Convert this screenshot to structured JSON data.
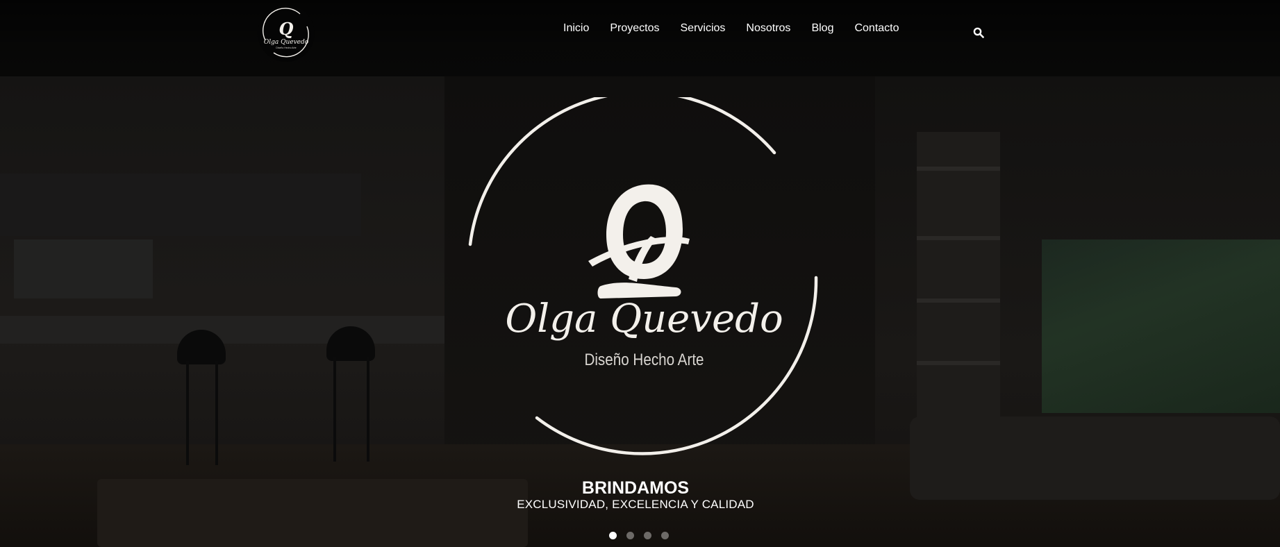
{
  "header": {
    "logo_alt": "Olga Quevedo",
    "logo_text": "Olga Quevedo",
    "logo_tagline": "Diseño Hecho Arte",
    "nav": [
      {
        "label": "Inicio"
      },
      {
        "label": "Proyectos"
      },
      {
        "label": "Servicios"
      },
      {
        "label": "Nosotros"
      },
      {
        "label": "Blog"
      },
      {
        "label": "Contacto"
      }
    ],
    "search_icon": "search-icon"
  },
  "hero": {
    "brand_name": "Olga Quevedo",
    "brand_tagline": "Diseño Hecho Arte",
    "heading": "BRINDAMOS",
    "subheading": "EXCLUSIVIDAD, EXCELENCIA Y CALIDAD",
    "slides": {
      "count": 4,
      "active": 1
    }
  },
  "colors": {
    "text": "#ffffff",
    "logo": "#f3f0eb",
    "dot_inactive": "#6d6a67",
    "dot_active": "#ffffff"
  }
}
